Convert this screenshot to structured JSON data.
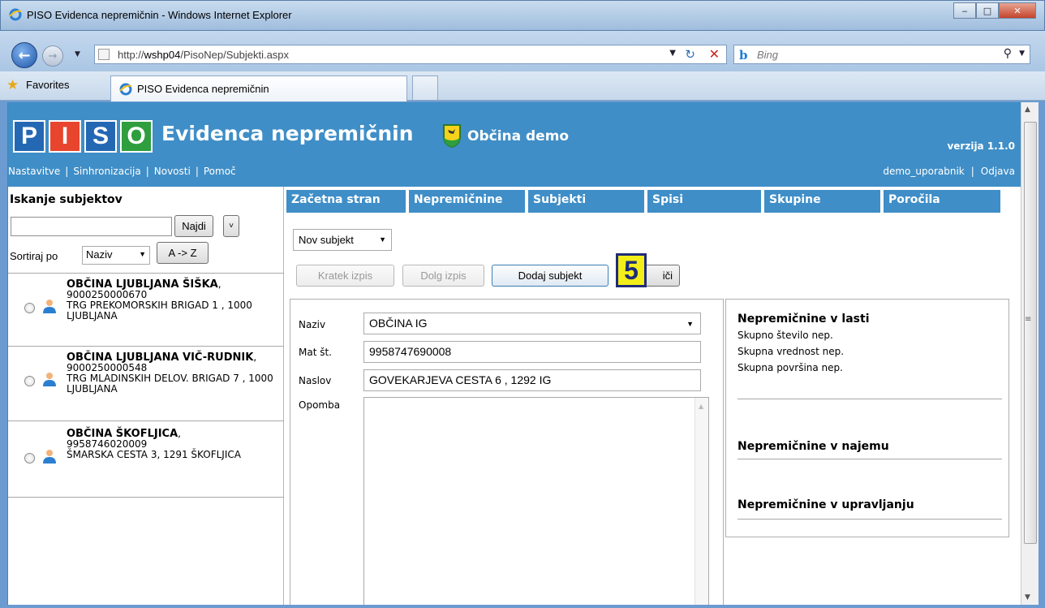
{
  "window": {
    "title": "PISO Evidenca nepremičnin - Windows Internet Explorer",
    "minimize": "‒",
    "maximize": "□",
    "close": "✕"
  },
  "browser": {
    "url_prefix": "http://",
    "url_host": "wshp04",
    "url_path": "/PisoNep/Subjekti.aspx",
    "search_placeholder": "Bing",
    "favorites_label": "Favorites",
    "tab_label": "PISO Evidenca nepremičnin"
  },
  "header": {
    "logo_letters": [
      "P",
      "I",
      "S",
      "O"
    ],
    "logo_colors": [
      "#2468b4",
      "#e8452e",
      "#2468b4",
      "#2e9e3f"
    ],
    "title": "Evidenca nepremičnin",
    "municipality": "Občina demo",
    "version": "verzija 1.1.0",
    "links": [
      "Nastavitve",
      "Sinhronizacija",
      "Novosti",
      "Pomoč"
    ],
    "user": "demo_uporabnik",
    "logout": "Odjava"
  },
  "left_panel": {
    "title": "Iskanje subjektov",
    "search_button": "Najdi",
    "expand_button": "˅",
    "sort_label": "Sortiraj po",
    "sort_value": "Naziv",
    "sort_order_button": "A -> Z",
    "subjects": [
      {
        "name": "OBČINA LJUBLJANA ŠIŠKA",
        "suffix": ",",
        "id": "9000250000670",
        "address": "TRG PREKOMORSKIH BRIGAD 1 , 1000 LJUBLJANA"
      },
      {
        "name": "OBČINA LJUBLJANA VIČ-RUDNIK",
        "suffix": ",",
        "id": "9000250000548",
        "address": "TRG MLADINSKIH DELOV. BRIGAD 7 , 1000 LJUBLJANA"
      },
      {
        "name": "OBČINA ŠKOFLJICA",
        "suffix": ",",
        "id": "9958746020009",
        "address": "ŠMARSKA CESTA 3, 1291 ŠKOFLJICA"
      }
    ]
  },
  "menu": [
    "Začetna stran",
    "Nepremičnine",
    "Subjekti",
    "Spisi",
    "Skupine",
    "Poročila"
  ],
  "toolbar": {
    "new_subject_select": "Nov subjekt",
    "short_print": "Kratek izpis",
    "long_print": "Dolg izpis",
    "add_subject": "Dodaj subjekt",
    "delete_partial": "iči",
    "step_badge": "5"
  },
  "form": {
    "naziv_label": "Naziv",
    "naziv_value": "OBČINA IG",
    "mat_label": "Mat št.",
    "mat_value": "9958747690008",
    "naslov_label": "Naslov",
    "naslov_value": "GOVEKARJEVA CESTA 6 , 1292 IG",
    "opomba_label": "Opomba",
    "opomba_value": ""
  },
  "side_panel": {
    "owned_title": "Nepremičnine v lasti",
    "owned_lines": [
      "Skupno število nep.",
      "Skupna vrednost nep.",
      "Skupna površina nep."
    ],
    "rented_title": "Nepremičnine v najemu",
    "managed_title": "Nepremičnine v upravljanju"
  }
}
